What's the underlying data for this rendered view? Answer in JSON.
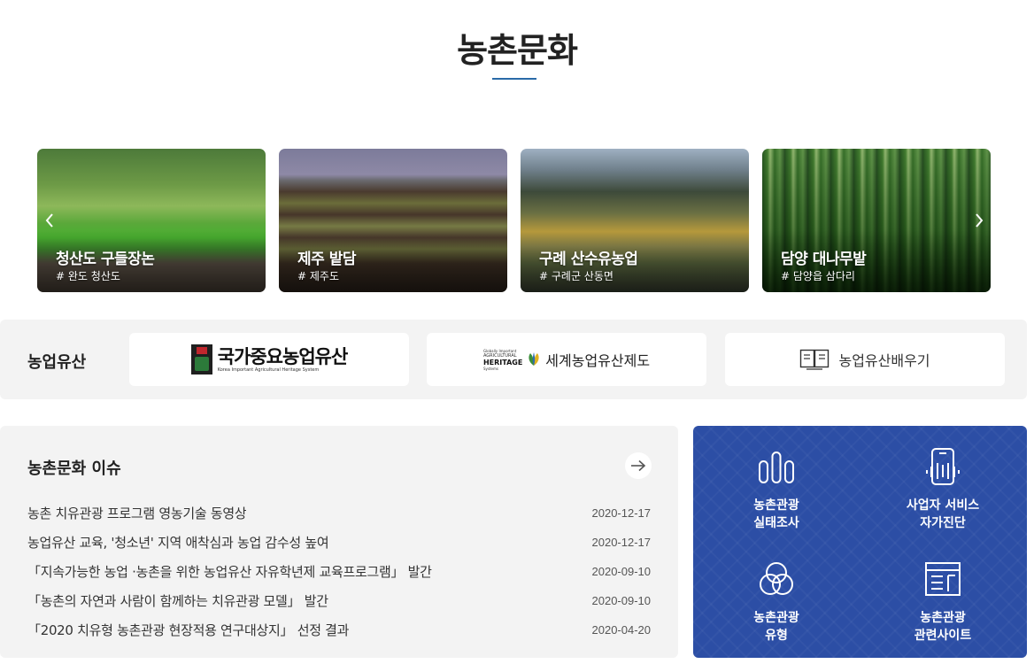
{
  "page": {
    "title": "농촌문화"
  },
  "carousel": {
    "prev_label": "‹",
    "next_label": "›",
    "cards": [
      {
        "name": "청산도 구들장논",
        "location": "# 완도 청산도"
      },
      {
        "name": "제주 밭담",
        "location": "# 제주도"
      },
      {
        "name": "구례 산수유농업",
        "location": "# 구례군 산동면"
      },
      {
        "name": "담양 대나무밭",
        "location": "# 담양읍 삼다리"
      }
    ]
  },
  "heritage": {
    "label": "농업유산",
    "korea_logo": {
      "text": "국가중요농업유산",
      "subtitle": "Korea Important Agricultural Heritage System"
    },
    "giahs": {
      "line1": "Globally Important",
      "line2": "AGRICULTURAL",
      "line3": "HERITAGE",
      "line4": "Systems",
      "text": "세계농업유산제도"
    },
    "learn": {
      "text": "농업유산배우기",
      "icon": "book-icon"
    }
  },
  "issues": {
    "title": "농촌문화 이슈",
    "more_icon": "arrow-right-icon",
    "items": [
      {
        "title": "농촌 치유관광 프로그램 영농기술 동영상",
        "date": "2020-12-17"
      },
      {
        "title": "농업유산 교육, '청소년' 지역 애착심과 농업 감수성 높여",
        "date": "2020-12-17"
      },
      {
        "title": "「지속가능한 농업 ·농촌을 위한 농업유산 자유학년제 교육프로그램」 발간",
        "date": "2020-09-10"
      },
      {
        "title": "「농촌의 자연과 사람이 함께하는 치유관광 모델」 발간",
        "date": "2020-09-10"
      },
      {
        "title": "「2020 치유형 농촌관광 현장적용 연구대상지」 선정 결과",
        "date": "2020-04-20"
      }
    ]
  },
  "services": {
    "background": "#2c4ea5",
    "items": [
      {
        "line1": "농촌관광",
        "line2": "실태조사",
        "icon": "bar-chart-icon"
      },
      {
        "line1": "사업자 서비스",
        "line2": "자가진단",
        "icon": "phone-diagnosis-icon"
      },
      {
        "line1": "농촌관광",
        "line2": "유형",
        "icon": "venn-circles-icon"
      },
      {
        "line1": "농촌관광",
        "line2": "관련사이트",
        "icon": "browser-window-icon"
      }
    ]
  }
}
